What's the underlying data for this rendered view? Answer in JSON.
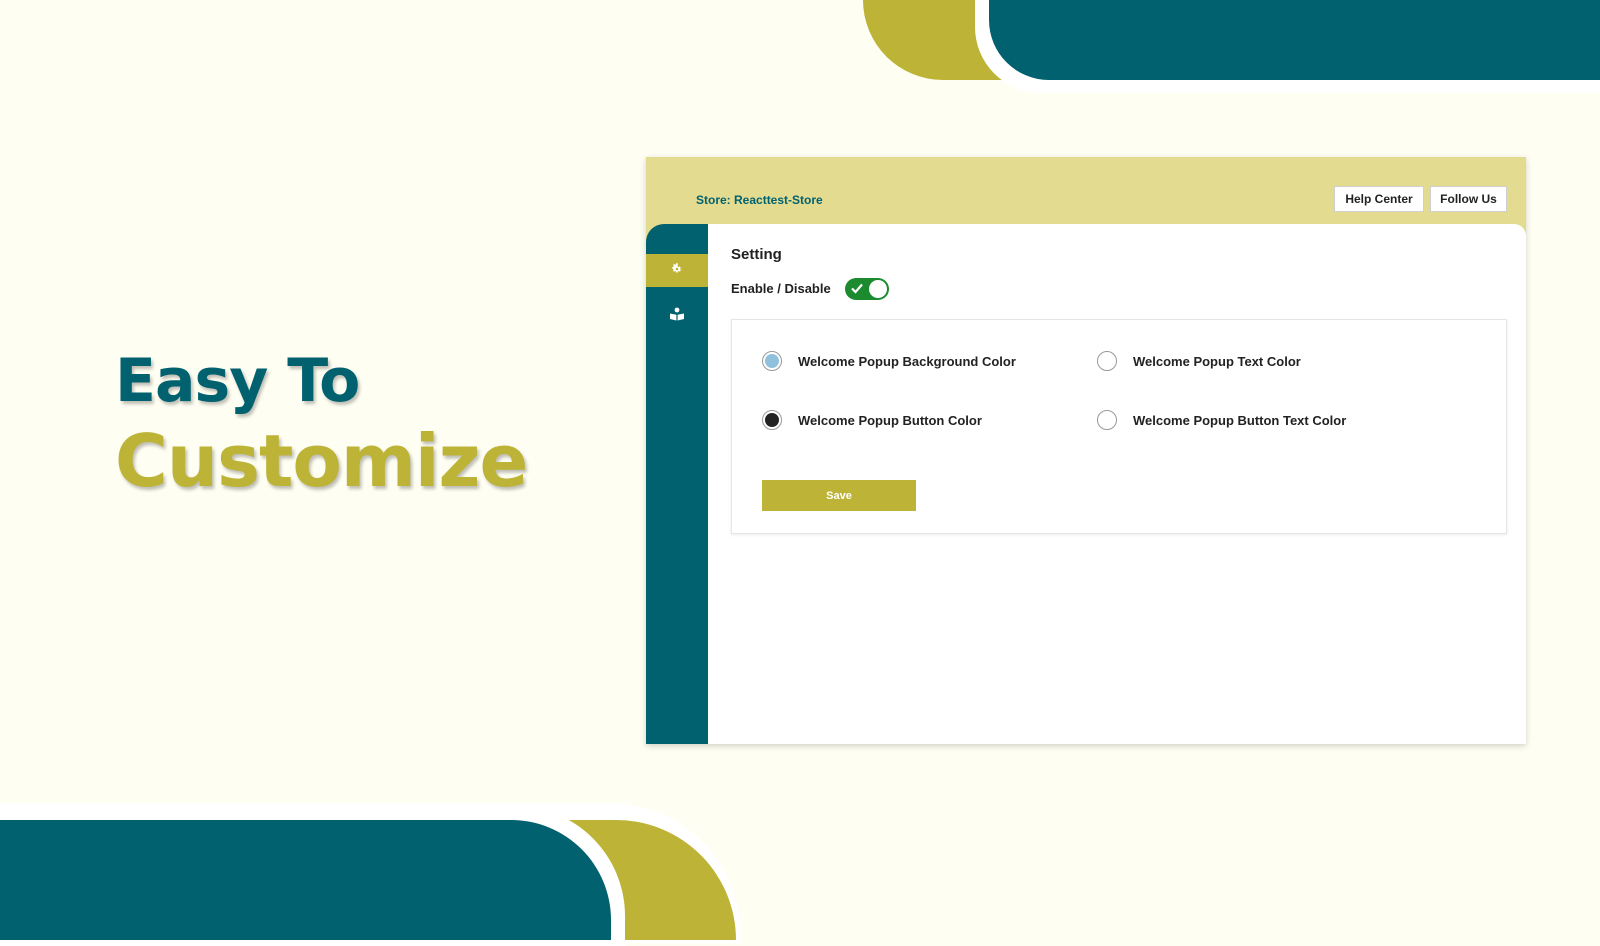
{
  "headline": {
    "line1": "Easy To",
    "line2": "Customize"
  },
  "header": {
    "store_label": "Store: Reacttest-Store",
    "help_center": "Help Center",
    "follow_us": "Follow Us"
  },
  "sidebar": {
    "items": [
      {
        "icon": "gear-icon",
        "active": true
      },
      {
        "icon": "book-user-icon",
        "active": false
      }
    ]
  },
  "settings": {
    "title": "Setting",
    "enable_label": "Enable / Disable",
    "enabled": true,
    "options": [
      {
        "label": "Welcome Popup Background Color",
        "color": "#8fc1dc"
      },
      {
        "label": "Welcome Popup Text Color",
        "color": "#ffffff"
      },
      {
        "label": "Welcome Popup Button Color",
        "color": "#222222"
      },
      {
        "label": "Welcome Popup Button Text Color",
        "color": "#ffffff"
      }
    ],
    "save_label": "Save"
  },
  "colors": {
    "teal": "#02616f",
    "olive": "#bdb336",
    "header_bg": "#e3dc90",
    "toggle_on": "#1c8a2f"
  }
}
